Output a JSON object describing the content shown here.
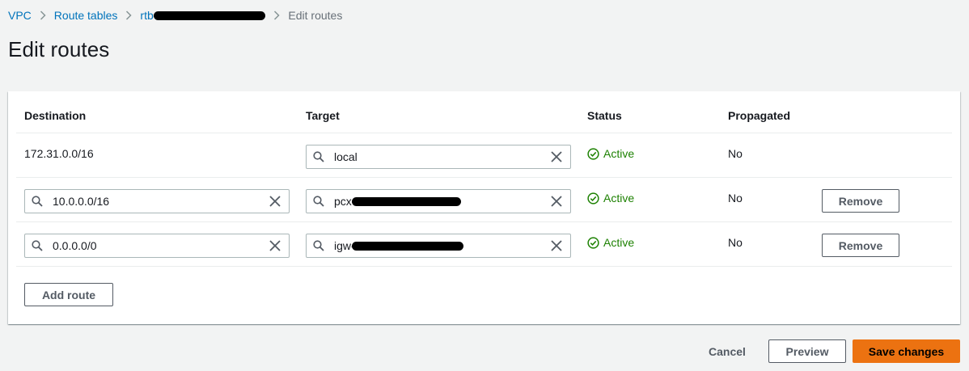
{
  "breadcrumb": {
    "items": [
      "VPC",
      "Route tables",
      "rtb-",
      "Edit routes"
    ]
  },
  "page": {
    "title": "Edit routes"
  },
  "table": {
    "headers": {
      "destination": "Destination",
      "target": "Target",
      "status": "Status",
      "propagated": "Propagated"
    },
    "rows": [
      {
        "destination": "172.31.0.0/16",
        "target": "local",
        "status": "Active",
        "propagated": "No"
      },
      {
        "destination": "10.0.0.0/16",
        "target": "pcx-",
        "status": "Active",
        "propagated": "No",
        "action": "Remove"
      },
      {
        "destination": "0.0.0.0/0",
        "target": "igw-",
        "status": "Active",
        "propagated": "No",
        "action": "Remove"
      }
    ],
    "add_route": "Add route"
  },
  "footer": {
    "cancel": "Cancel",
    "preview": "Preview",
    "save": "Save changes"
  },
  "colors": {
    "link": "#0073bb",
    "active": "#1d8102",
    "primary": "#ec7211"
  },
  "icons": [
    "chevron-right-icon",
    "search-icon",
    "clear-icon",
    "status-active-icon"
  ]
}
